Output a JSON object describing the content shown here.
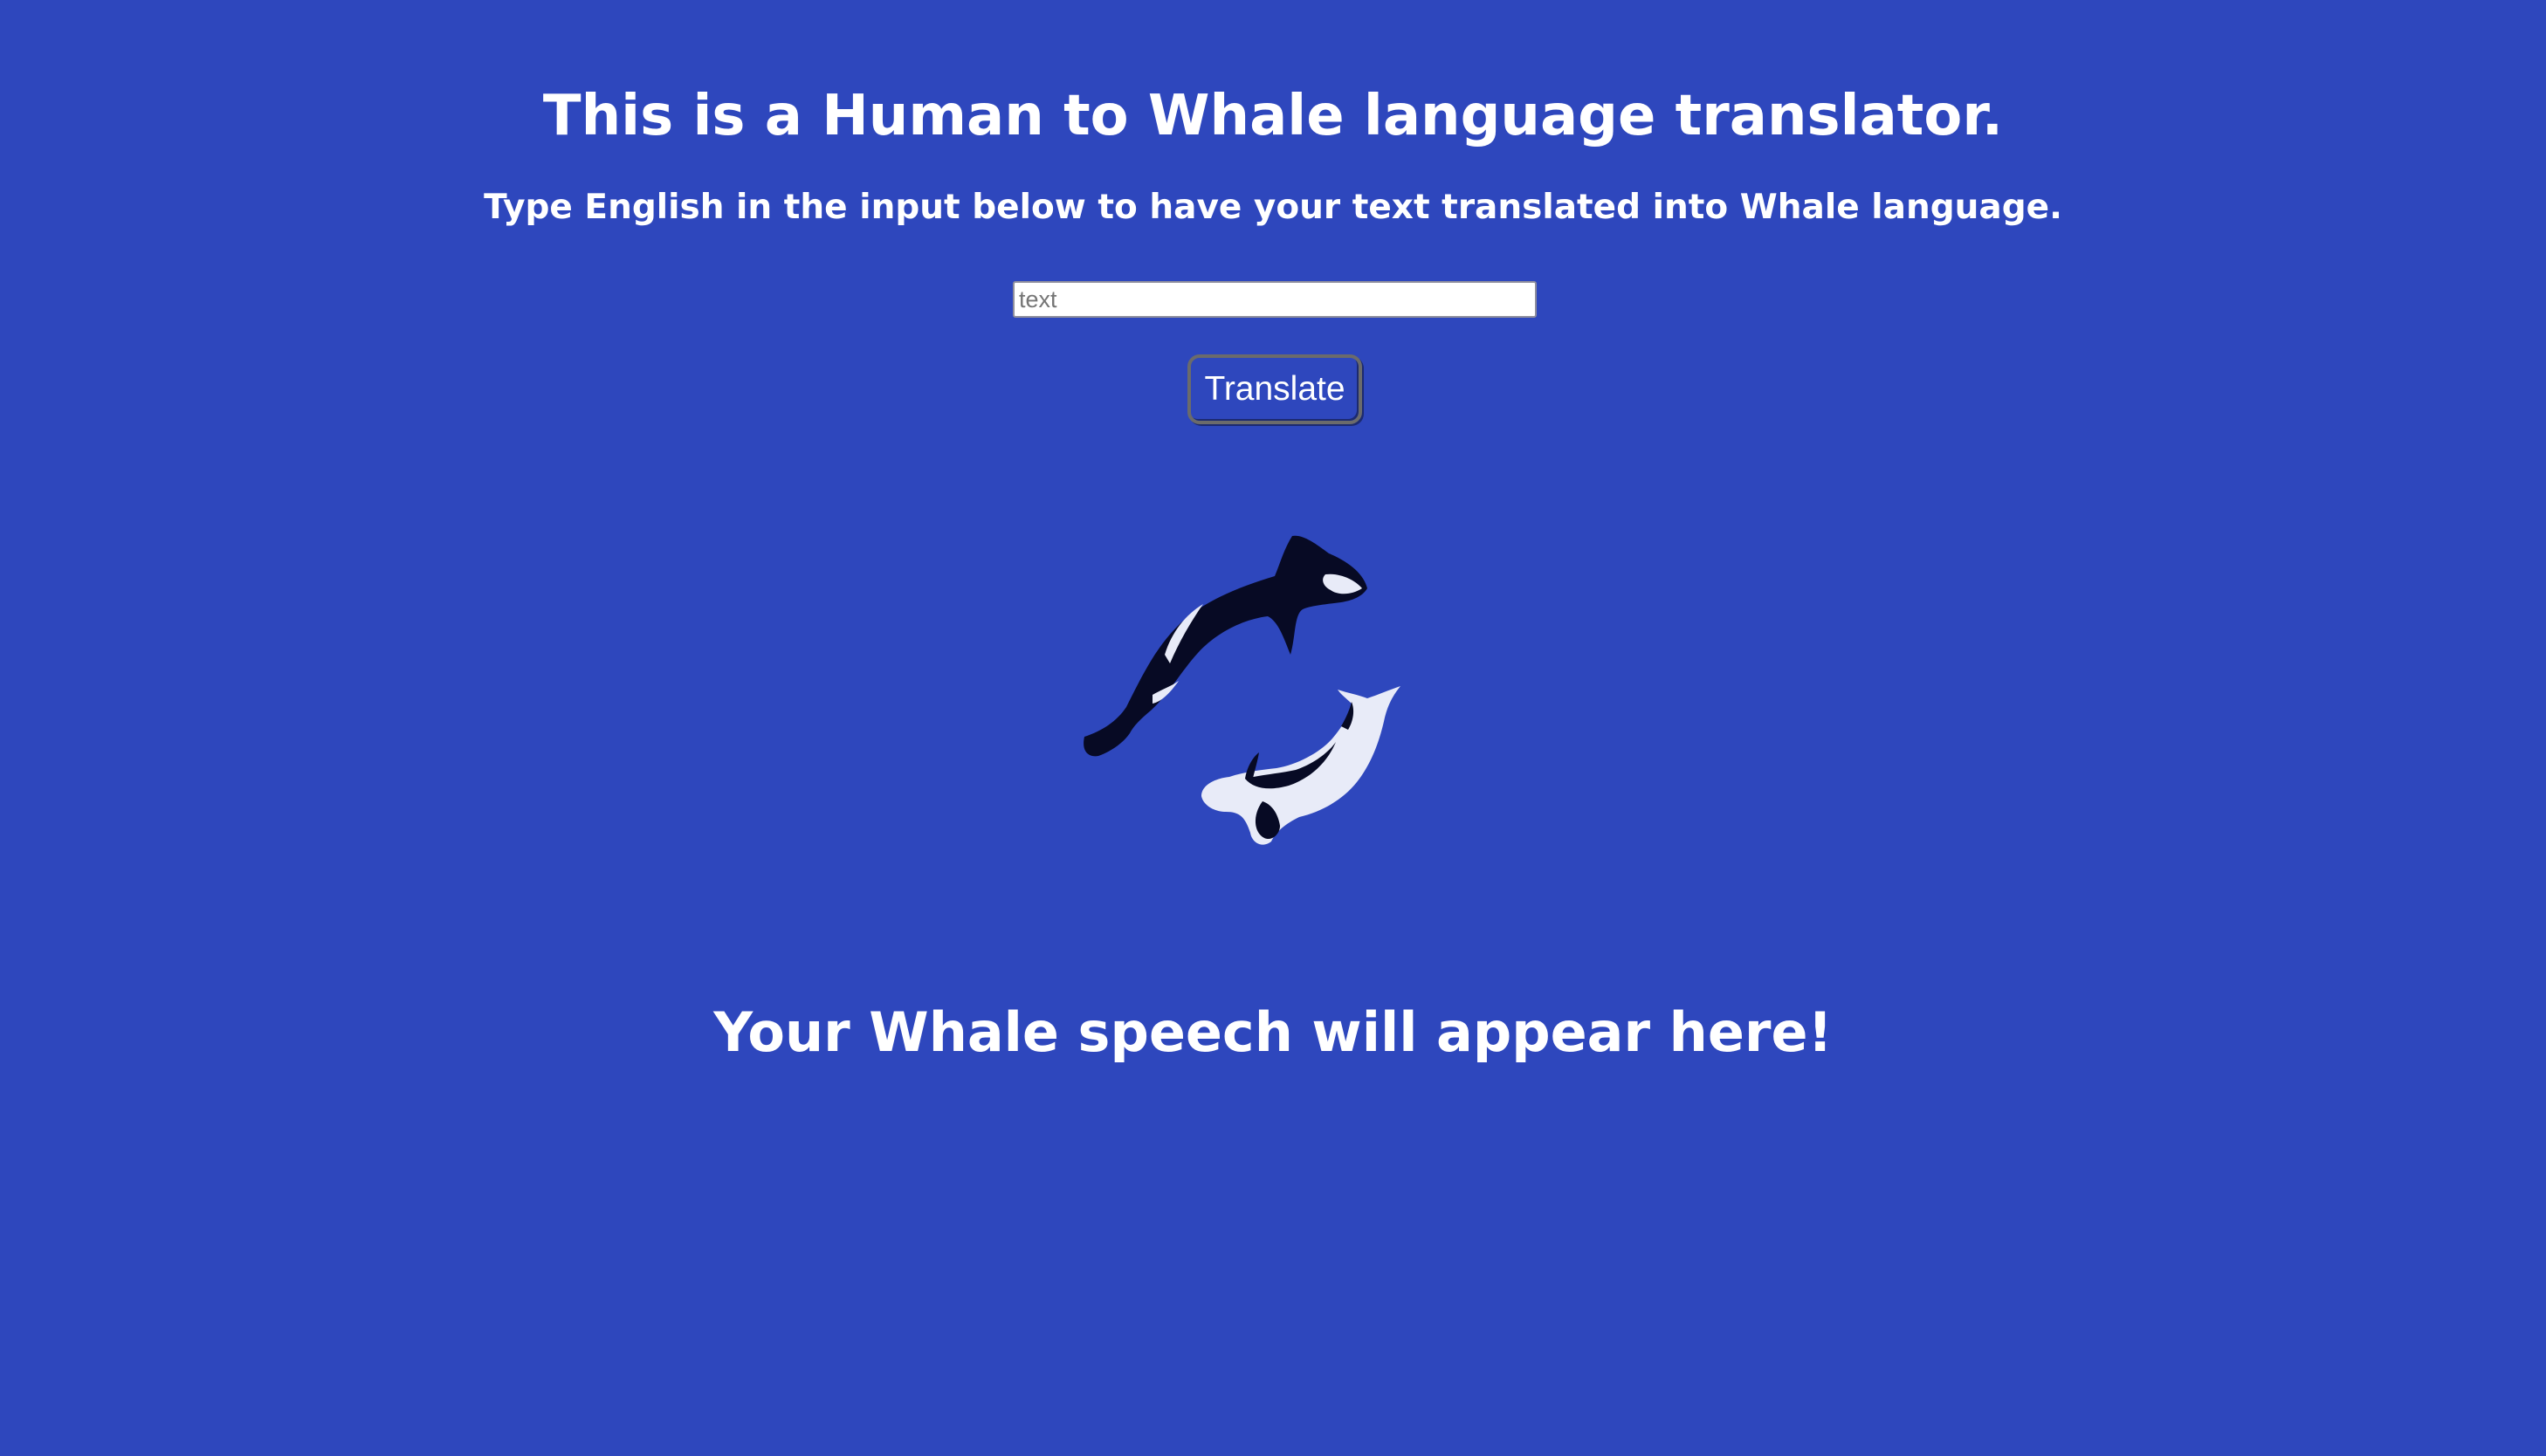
{
  "header": {
    "title": "This is a Human to Whale language translator.",
    "subtitle": "Type English in the input below to have your text translated into Whale language."
  },
  "form": {
    "input_value": "",
    "input_placeholder": "text",
    "button_label": "Translate"
  },
  "illustration": {
    "icon": "orca-whales-icon",
    "colors": {
      "dark_whale": "#070a24",
      "light_whale": "#e8ebf8",
      "background": "#2e47bd"
    }
  },
  "output": {
    "text": "Your Whale speech will appear here!"
  }
}
